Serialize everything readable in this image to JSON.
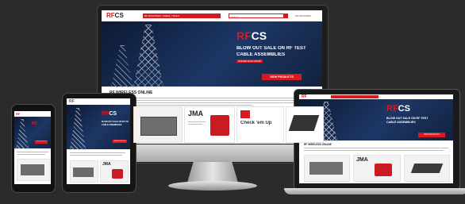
{
  "site": {
    "brand_mark": "RF",
    "brand_suffix": "CS",
    "nav_items": [
      "RF ADAPTERS",
      "CABLE",
      "TOOLS",
      "CONNECTORS",
      "TEST"
    ],
    "search_placeholder": "Search",
    "header_link": "MY ACCOUNT"
  },
  "hero": {
    "headline_line1": "BLOW OUT SALE ON RF TEST",
    "headline_line2": "CABLE ASSEMBLIES",
    "subhead": "ONLINE EXCLUSIVE",
    "cta_label": "VIEW PRODUCTS"
  },
  "welcome": {
    "title": "RF WIRELESS ONLINE"
  },
  "products": {
    "brand_jma": "JMA",
    "promo_caption": "Check 'em Up"
  },
  "colors": {
    "background": "#2b2b2b",
    "brand_red": "#d71920",
    "hero_navy": "#1d3766"
  }
}
